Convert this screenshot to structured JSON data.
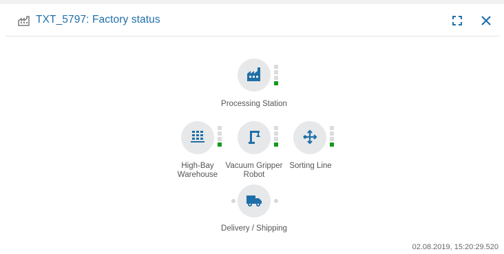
{
  "window": {
    "title": "TXT_5797: Factory status",
    "icon": "factory-icon",
    "maximize_icon": "maximize-icon",
    "close_icon": "close-icon"
  },
  "stations": [
    {
      "id": "processing",
      "label": "Processing Station",
      "icon": "factory-icon",
      "status": [
        "off",
        "off",
        "off",
        "green"
      ]
    },
    {
      "id": "highbay",
      "label": "High-Bay\nWarehouse",
      "icon": "warehouse-icon",
      "status": [
        "off",
        "off",
        "off",
        "green"
      ]
    },
    {
      "id": "vgr",
      "label": "Vacuum Gripper\nRobot",
      "icon": "crane-icon",
      "status": [
        "off",
        "off",
        "off",
        "green"
      ]
    },
    {
      "id": "sorting",
      "label": "Sorting Line",
      "icon": "sorting-icon",
      "status": [
        "off",
        "off",
        "off",
        "green"
      ]
    },
    {
      "id": "delivery",
      "label": "Delivery / Shipping",
      "icon": "truck-icon"
    }
  ],
  "colors": {
    "accent": "#1f6fa8",
    "status_green": "#159a1e",
    "status_off": "#dcdcdc",
    "circle": "#e7e8e9"
  },
  "timestamp": "02.08.2019, 15:20:29.520"
}
